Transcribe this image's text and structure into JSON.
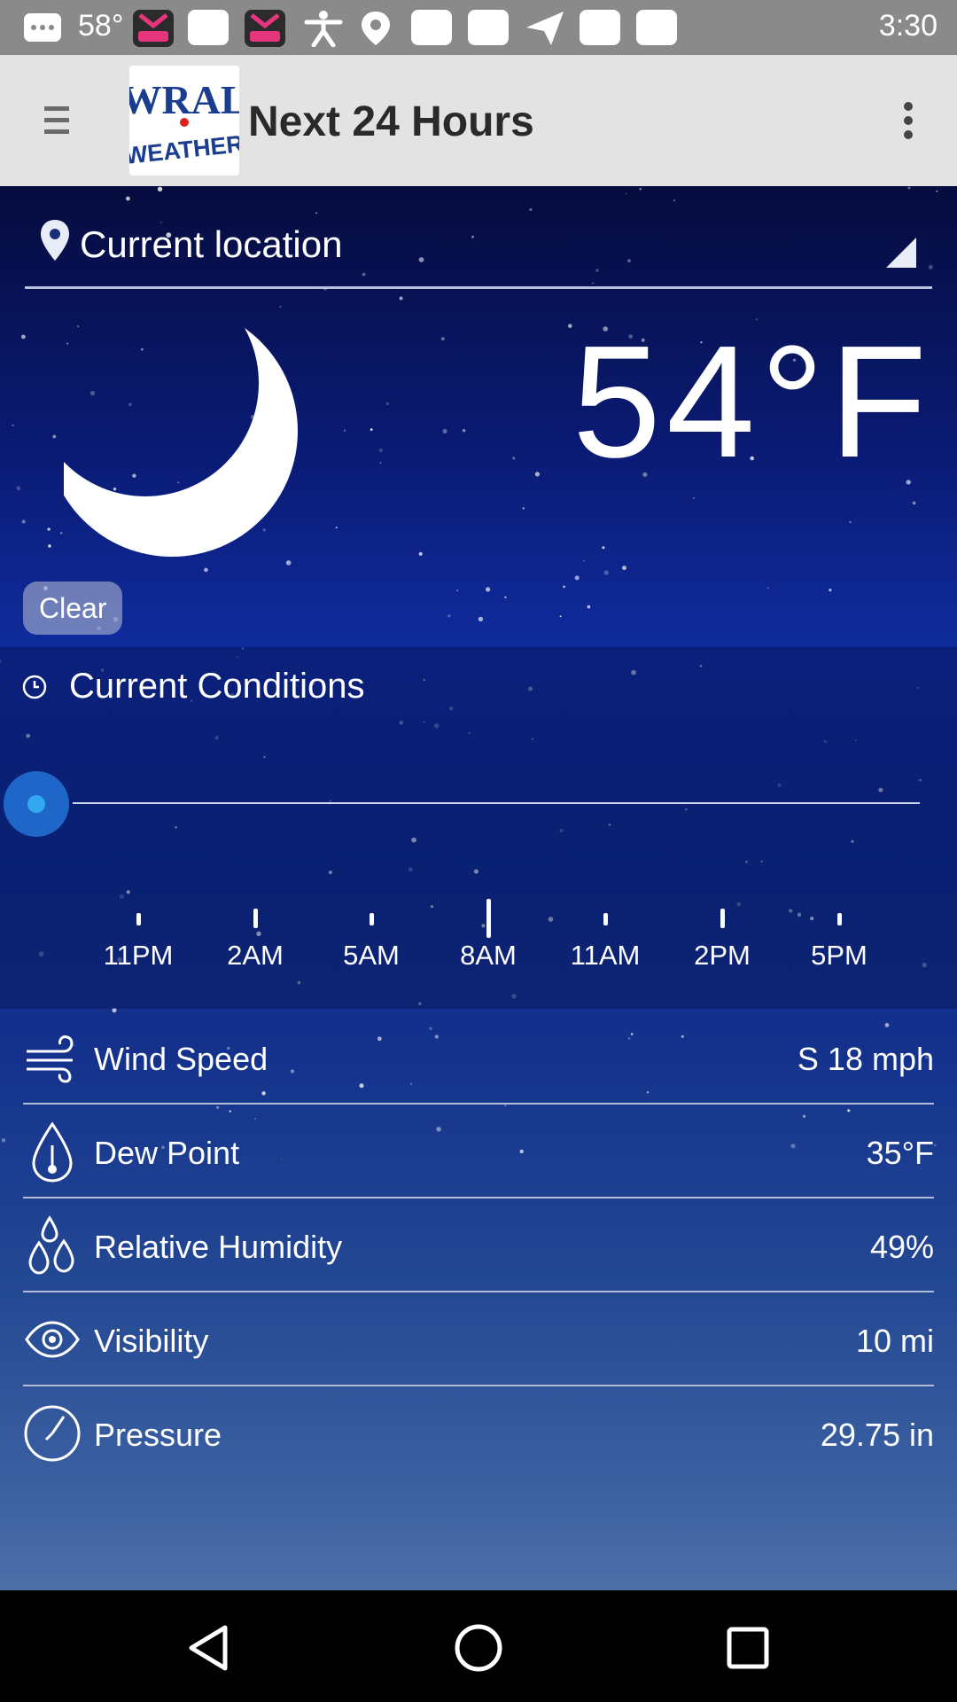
{
  "status_bar": {
    "temperature": "58°",
    "time": "3:30",
    "notification_icons": [
      "pop-icon",
      "notification-icon",
      "pop-icon",
      "accessibility-icon",
      "location-icon",
      "notification-icon",
      "notification-icon",
      "send-icon",
      "notification-icon",
      "notification-icon"
    ]
  },
  "app_bar": {
    "title": "Next 24 Hours",
    "logo_line1": "WRAL",
    "logo_line2": "WEATHER"
  },
  "location": {
    "label": "Current location"
  },
  "current": {
    "temperature": "54°F",
    "condition": "Clear",
    "icon": "moon-icon"
  },
  "conditions": {
    "title": "Current Conditions",
    "timeline_position": 0,
    "timeline_labels": [
      "11PM",
      "2AM",
      "5AM",
      "8AM",
      "11AM",
      "2PM",
      "5PM"
    ]
  },
  "details": [
    {
      "icon": "wind-icon",
      "label": "Wind Speed",
      "value": "S 18 mph"
    },
    {
      "icon": "dew-point-icon",
      "label": "Dew Point",
      "value": "35°F"
    },
    {
      "icon": "humidity-icon",
      "label": "Relative Humidity",
      "value": "49%"
    },
    {
      "icon": "eye-icon",
      "label": "Visibility",
      "value": "10 mi"
    },
    {
      "icon": "pressure-gauge-icon",
      "label": "Pressure",
      "value": "29.75 in"
    }
  ],
  "nav_bar": {
    "buttons": [
      "back-icon",
      "home-icon",
      "recents-icon"
    ]
  },
  "colors": {
    "accent": "#1e66c8",
    "sky_top": "#060c3e",
    "sky_bottom": "#4e6fa8"
  }
}
